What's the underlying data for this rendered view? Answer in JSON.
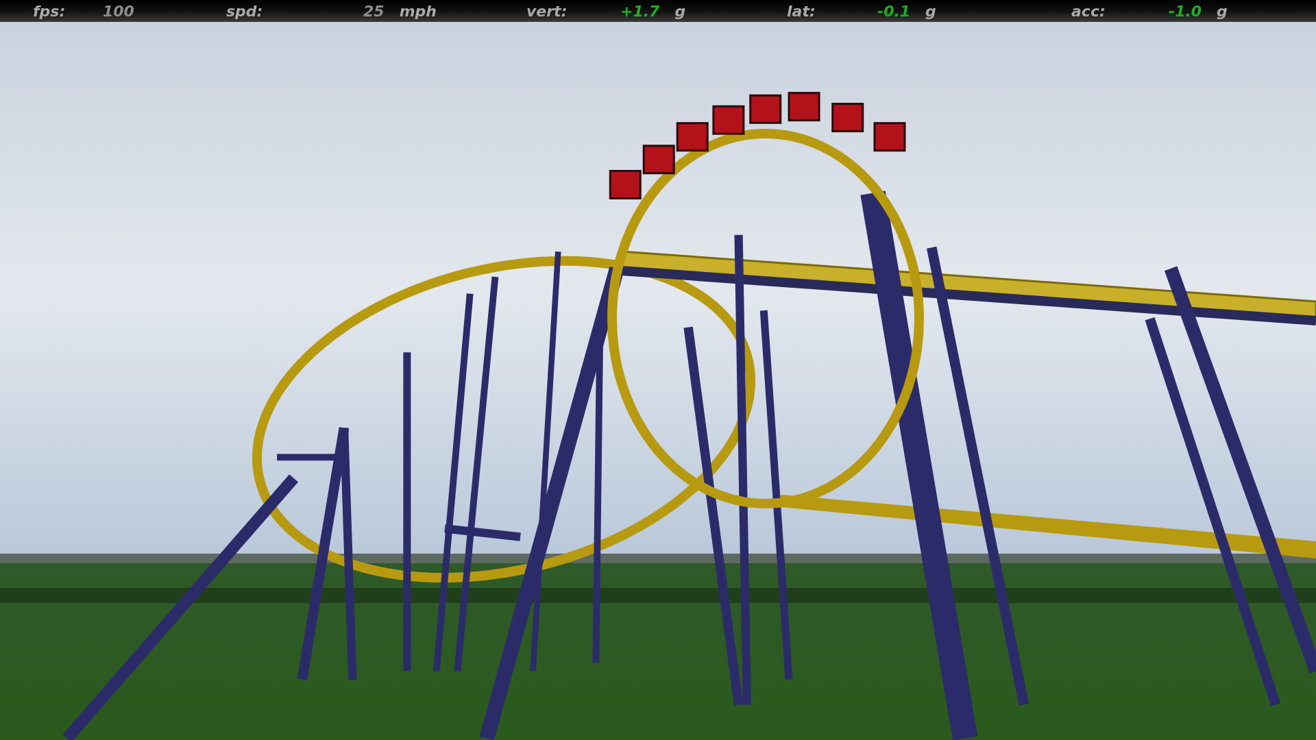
{
  "hud": [
    {
      "label": "fps:",
      "value": "100",
      "kind": "plain"
    },
    {
      "label": "spd:",
      "value": "25",
      "unit": "mph",
      "kind": "plain"
    },
    {
      "label": "vert:",
      "value": "+1.7",
      "unit": "g",
      "kind": "force"
    },
    {
      "label": "lat:",
      "value": "-0.1",
      "unit": "g",
      "kind": "force"
    },
    {
      "label": "acc:",
      "value": "-1.0",
      "unit": "g",
      "kind": "force"
    }
  ]
}
